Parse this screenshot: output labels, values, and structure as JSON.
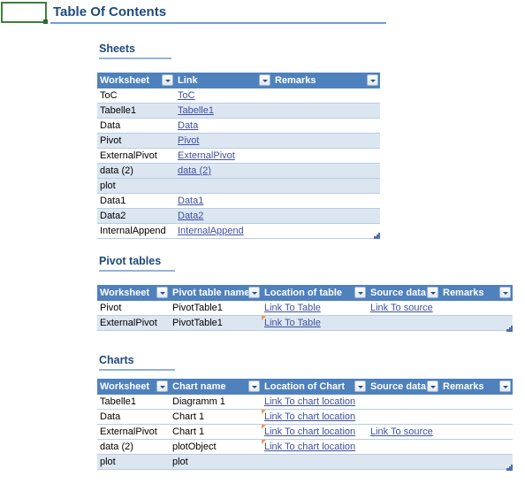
{
  "title": "Table Of Contents",
  "active_cell": {
    "value": ""
  },
  "sections": {
    "sheets": {
      "heading": "Sheets",
      "columns": [
        "Worksheet",
        "Link",
        "Remarks"
      ],
      "rows": [
        {
          "worksheet": "ToC",
          "link": "ToC",
          "remarks": ""
        },
        {
          "worksheet": "Tabelle1",
          "link": "Tabelle1",
          "remarks": ""
        },
        {
          "worksheet": "Data",
          "link": "Data",
          "remarks": ""
        },
        {
          "worksheet": "Pivot",
          "link": "Pivot",
          "remarks": ""
        },
        {
          "worksheet": "ExternalPivot",
          "link": "ExternalPivot",
          "remarks": ""
        },
        {
          "worksheet": "data (2)",
          "link": "data (2)",
          "remarks": ""
        },
        {
          "worksheet": "plot",
          "link": "",
          "remarks": ""
        },
        {
          "worksheet": "Data1",
          "link": "Data1",
          "remarks": ""
        },
        {
          "worksheet": "Data2",
          "link": "Data2",
          "remarks": ""
        },
        {
          "worksheet": "InternalAppend",
          "link": "InternalAppend",
          "remarks": ""
        }
      ]
    },
    "pivot_tables": {
      "heading": "Pivot tables",
      "columns": [
        "Worksheet",
        "Pivot table name",
        "Location of table",
        "Source data",
        "Remarks"
      ],
      "rows": [
        {
          "worksheet": "Pivot",
          "name": "PivotTable1",
          "location": "Link To Table",
          "source": "Link To source",
          "remarks": "",
          "comment": false
        },
        {
          "worksheet": "ExternalPivot",
          "name": "PivotTable1",
          "location": "Link To Table",
          "source": "",
          "remarks": "",
          "comment": true
        }
      ]
    },
    "charts": {
      "heading": "Charts",
      "columns": [
        "Worksheet",
        "Chart name",
        "Location of Chart",
        "Source data",
        "Remarks"
      ],
      "rows": [
        {
          "worksheet": "Tabelle1",
          "name": "Diagramm 1",
          "location": "Link To chart location",
          "source": "",
          "remarks": "",
          "comment": false
        },
        {
          "worksheet": "Data",
          "name": "Chart 1",
          "location": "Link To chart location",
          "source": "",
          "remarks": "",
          "comment": true
        },
        {
          "worksheet": "ExternalPivot",
          "name": "Chart 1",
          "location": "Link To chart location",
          "source": "Link To source",
          "remarks": "",
          "comment": true
        },
        {
          "worksheet": "data (2)",
          "name": "plotObject",
          "location": "Link To chart location",
          "source": "",
          "remarks": "",
          "comment": true
        },
        {
          "worksheet": "plot",
          "name": "plot",
          "location": "",
          "source": "",
          "remarks": "",
          "comment": false
        }
      ]
    }
  },
  "colors": {
    "header_blue": "#4f81bd",
    "band_blue": "#dce6f1",
    "title_blue": "#1f497d",
    "link_blue": "#3f50a0",
    "grid_blue": "#b8cce4",
    "comment_orange": "#f79646",
    "selection_green": "#3f7d3f"
  }
}
